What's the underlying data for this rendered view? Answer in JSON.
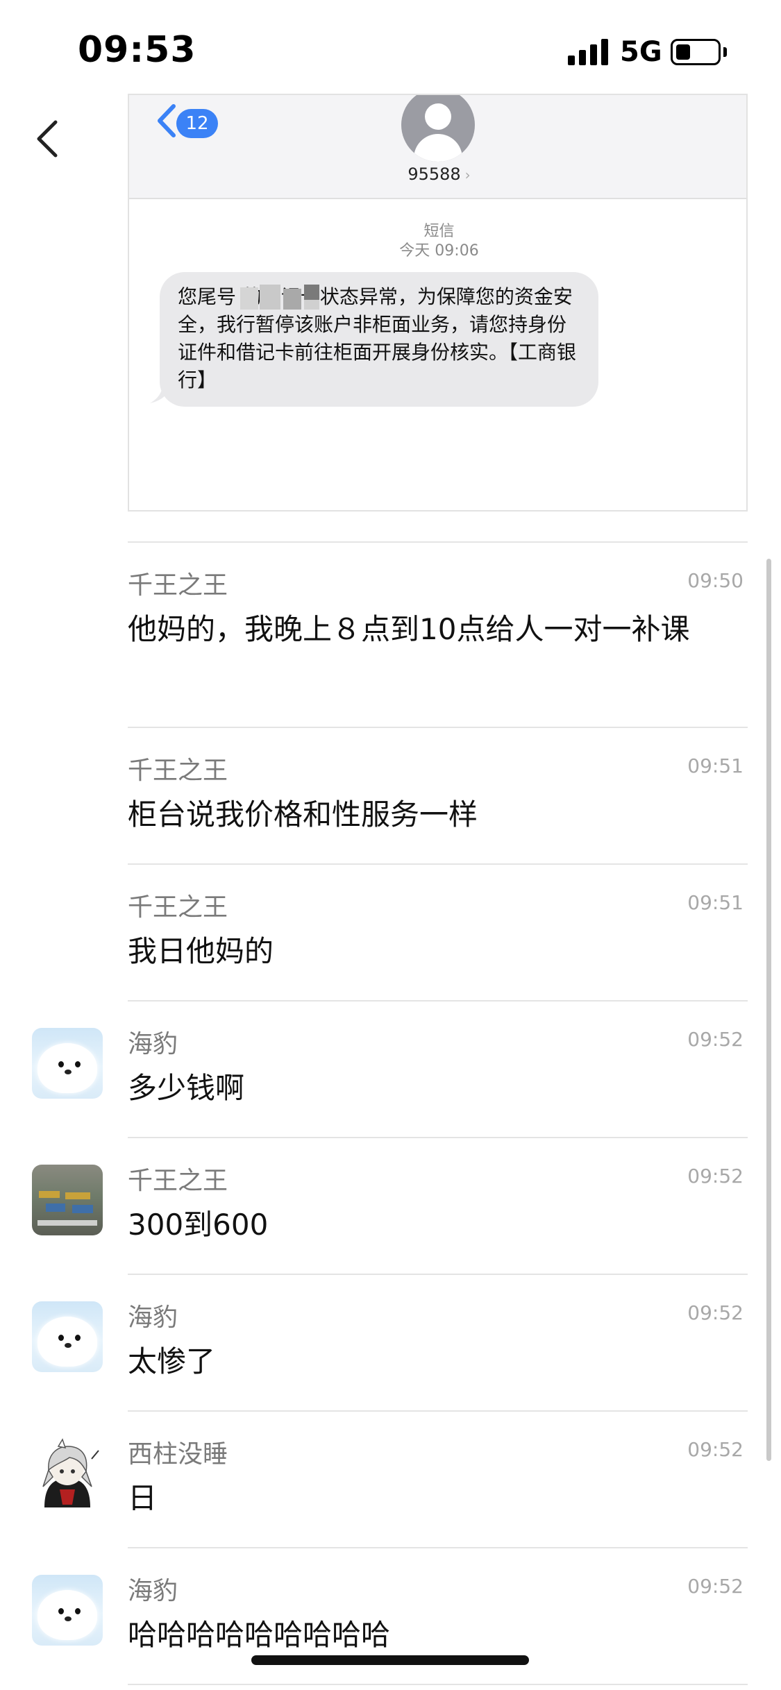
{
  "status_bar": {
    "time": "09:53",
    "network": "5G",
    "battery_level": 0.35
  },
  "nav": {
    "back_icon": "chevron-left-icon",
    "more_icon": "ellipsis-icon"
  },
  "sms_screenshot": {
    "badge_count": "12",
    "sender_number": "95588",
    "number_chevron": "›",
    "label": "短信",
    "timestamp": "今天 09:06",
    "body": "您尾号      的借记卡状态异常，为保障您的资金安全，我行暂停该账户非柜面业务，请您持身份证件和借记卡前往柜面开展身份核实。【工商银行】"
  },
  "messages": [
    {
      "sender": "千王之王",
      "time": "09:50",
      "content": "他妈的，我晚上８点到10点给人一对一补课",
      "avatar": "none"
    },
    {
      "sender": "千王之王",
      "time": "09:51",
      "content": "柜台说我价格和性服务一样",
      "avatar": "none"
    },
    {
      "sender": "千王之王",
      "time": "09:51",
      "content": "我日他妈的",
      "avatar": "none"
    },
    {
      "sender": "海豹",
      "time": "09:52",
      "content": "多少钱啊",
      "avatar": "seal"
    },
    {
      "sender": "千王之王",
      "time": "09:52",
      "content": "300到600",
      "avatar": "photo"
    },
    {
      "sender": "海豹",
      "time": "09:52",
      "content": "太惨了",
      "avatar": "seal"
    },
    {
      "sender": "西柱没睡",
      "time": "09:52",
      "content": "日",
      "avatar": "anime"
    },
    {
      "sender": "海豹",
      "time": "09:52",
      "content": "哈哈哈哈哈哈哈哈哈",
      "avatar": "seal"
    }
  ]
}
